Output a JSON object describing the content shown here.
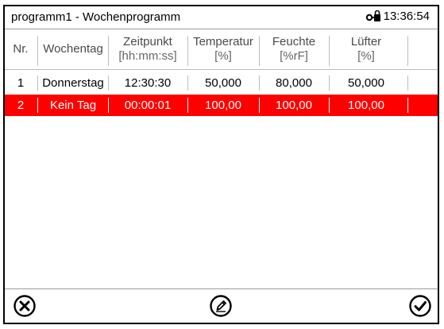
{
  "window": {
    "title": "programm1 - Wochenprogramm",
    "time": "13:36:54",
    "lock_icon": "key-lock-icon"
  },
  "table": {
    "columns": [
      {
        "label": "Nr.",
        "unit": ""
      },
      {
        "label": "Wochentag",
        "unit": ""
      },
      {
        "label": "Zeitpunkt",
        "unit": "[hh:mm:ss]"
      },
      {
        "label": "Temperatur",
        "unit": "[%]"
      },
      {
        "label": "Feuchte",
        "unit": "[%rF]"
      },
      {
        "label": "Lüfter",
        "unit": "[%]"
      }
    ],
    "rows": [
      {
        "nr": "1",
        "day": "Donnerstag",
        "time": "12:30:30",
        "temp": "50,000",
        "hum": "80,000",
        "fan": "50,000",
        "selected": false
      },
      {
        "nr": "2",
        "day": "Kein Tag",
        "time": "00:00:01",
        "temp": "100,00",
        "hum": "100,00",
        "fan": "100,00",
        "selected": true
      }
    ]
  },
  "footer": {
    "cancel_icon": "close-circle-icon",
    "edit_icon": "edit-pencil-icon",
    "confirm_icon": "checkmark-circle-icon"
  },
  "colors": {
    "selected_row": "#ff0000"
  }
}
